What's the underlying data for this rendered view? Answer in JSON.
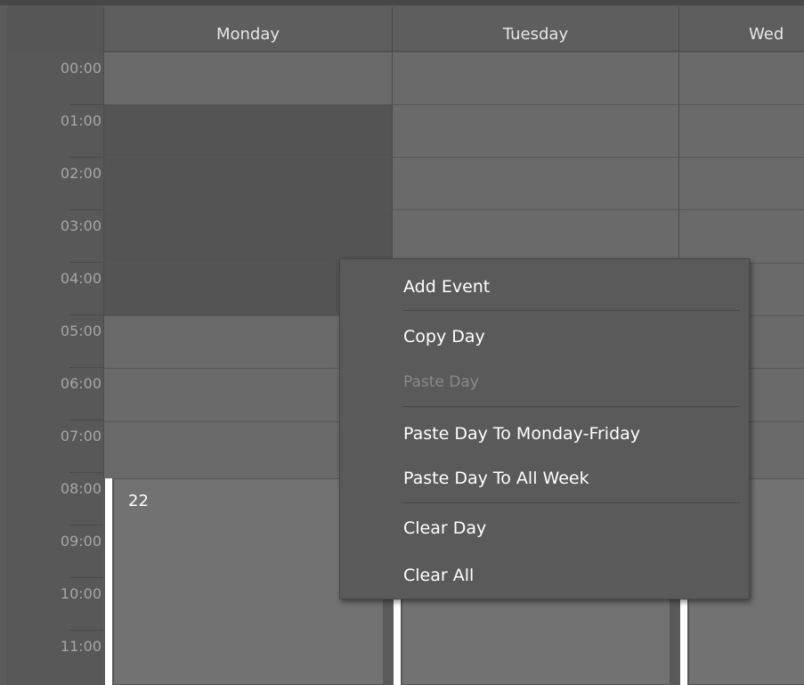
{
  "scheduler": {
    "days": [
      {
        "label": "Monday"
      },
      {
        "label": "Tuesday"
      },
      {
        "label": "Wed"
      }
    ],
    "times": [
      "00:00",
      "01:00",
      "02:00",
      "03:00",
      "04:00",
      "05:00",
      "06:00",
      "07:00",
      "08:00",
      "09:00",
      "10:00",
      "11:00"
    ],
    "event": {
      "value": "22"
    }
  },
  "context_menu": {
    "items": [
      {
        "label": "Add Event",
        "enabled": true
      },
      {
        "label": "Copy Day",
        "enabled": true
      },
      {
        "label": "Paste Day",
        "enabled": false
      },
      {
        "label": "Paste Day To Monday-Friday",
        "enabled": true
      },
      {
        "label": "Paste Day To All Week",
        "enabled": true
      },
      {
        "label": "Clear Day",
        "enabled": true
      },
      {
        "label": "Clear All",
        "enabled": true
      }
    ]
  },
  "colors": {
    "background": "#5b5b5b",
    "cell_light": "#6a6a6a",
    "cell_dark": "#545454",
    "event_block": "#727272",
    "event_strip": "#ffffff",
    "menu_background": "#5a5a5a",
    "menu_text": "#ffffff",
    "menu_text_disabled": "#8a8a8a"
  }
}
